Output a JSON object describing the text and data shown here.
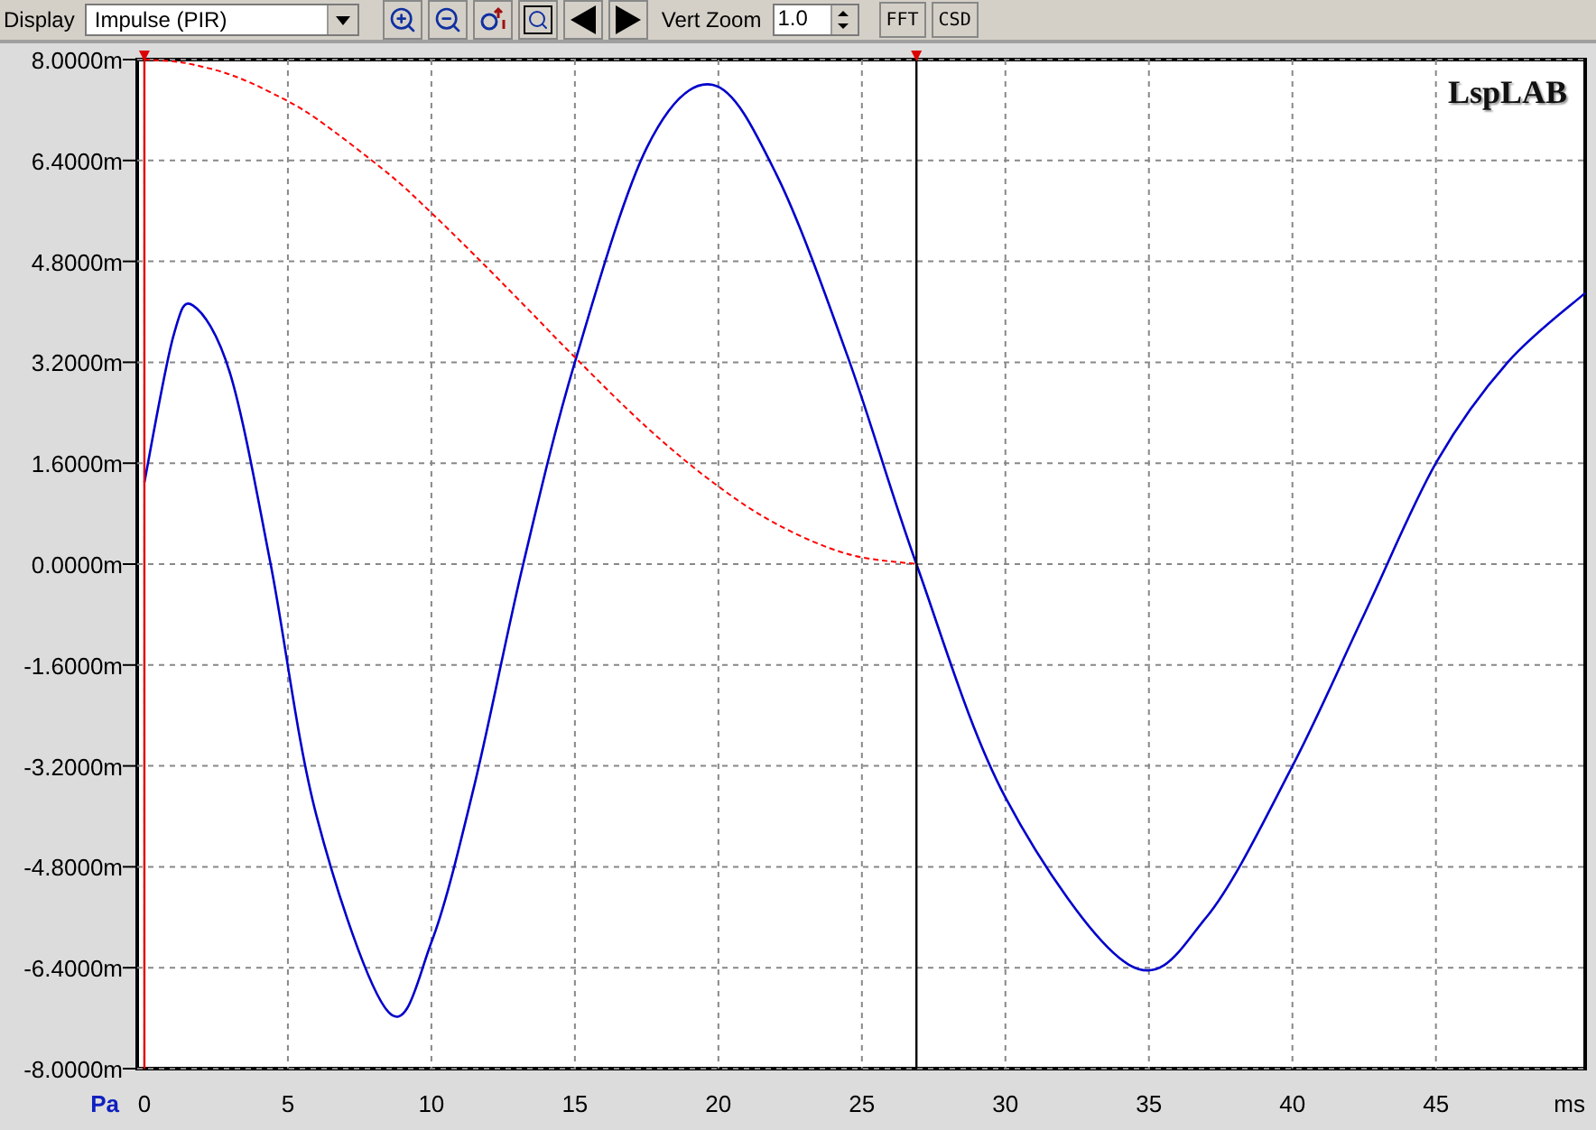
{
  "toolbar": {
    "display_label": "Display",
    "display_select": "Impulse (PIR)",
    "tool_buttons": [
      {
        "kind": "zoom-in"
      },
      {
        "kind": "zoom-out"
      },
      {
        "kind": "zoom-reset"
      },
      {
        "kind": "zoom-box"
      },
      {
        "kind": "previous"
      },
      {
        "kind": "next"
      }
    ],
    "vert_zoom_label": "Vert Zoom",
    "vert_zoom_value": "1.0",
    "buttons": [
      "FFT",
      "CSD"
    ]
  },
  "plot": {
    "logo": "LspLAB",
    "chart_data": {
      "type": "line",
      "xlabel": "ms",
      "ylabel": "Pa",
      "x": [
        0,
        1,
        1.7,
        3,
        4.4,
        6,
        8.5,
        10,
        11.5,
        13.2,
        15,
        17.5,
        19.8,
        22,
        24.5,
        26.9,
        30,
        34.3,
        37,
        40,
        42.5,
        45,
        47.5,
        50.2
      ],
      "series": [
        {
          "color": "#0000cc",
          "line_style": "solid",
          "values": [
            1.3,
            3.6,
            4.1,
            3.0,
            0,
            -4.0,
            -7.1,
            -6.0,
            -3.5,
            0,
            3.2,
            6.6,
            7.6,
            6.2,
            3.3,
            0,
            -3.7,
            -6.35,
            -5.6,
            -3.2,
            -0.8,
            1.6,
            3.2,
            4.3
          ]
        },
        {
          "color": "#ff0000",
          "line_style": "dashed",
          "values": [
            8,
            7.97,
            7.92,
            7.76,
            7.48,
            7.06,
            6.19,
            5.57,
            4.9,
            4.12,
            3.28,
            2.17,
            1.3,
            0.64,
            0.16,
            0,
            null,
            null,
            null,
            null,
            null,
            null,
            null,
            null
          ]
        }
      ],
      "xlim": [
        -0.25,
        50.2
      ],
      "ylim": [
        -8,
        8
      ],
      "xticks": [
        0,
        5,
        10,
        15,
        20,
        25,
        30,
        35,
        40,
        45
      ],
      "yticks": [
        {
          "value": 8,
          "label": "8.0000m"
        },
        {
          "value": 6.4,
          "label": "6.4000m"
        },
        {
          "value": 4.8,
          "label": "4.8000m"
        },
        {
          "value": 3.2,
          "label": "3.2000m"
        },
        {
          "value": 1.6,
          "label": "1.6000m"
        },
        {
          "value": 0,
          "label": "0.0000m"
        },
        {
          "value": -1.6,
          "label": "-1.6000m"
        },
        {
          "value": -3.2,
          "label": "-3.2000m"
        },
        {
          "value": -4.8,
          "label": "-4.8000m"
        },
        {
          "value": -6.4,
          "label": "-6.4000m"
        },
        {
          "value": -8,
          "label": "-8.0000m"
        }
      ],
      "grid": true,
      "ref_lines": [
        {
          "axis": "x",
          "value": 0,
          "color": "#dd0000"
        },
        {
          "axis": "x",
          "value": 26.9,
          "color": "#000000"
        }
      ]
    }
  }
}
